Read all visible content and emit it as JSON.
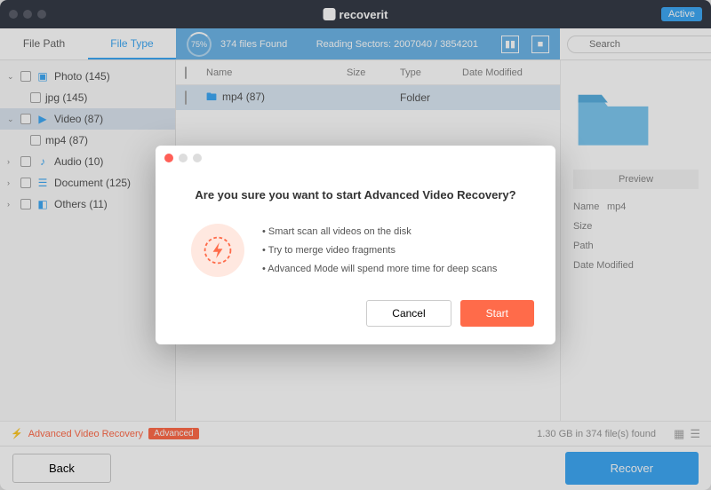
{
  "brand": "recoverit",
  "active_badge": "Active",
  "tabs": {
    "file_path": "File Path",
    "file_type": "File Type"
  },
  "scan": {
    "percent": "75%",
    "files_found": "374 files Found",
    "sectors": "Reading Sectors: 2007040 / 3854201"
  },
  "search": {
    "placeholder": "Search"
  },
  "sidebar": {
    "photo": {
      "label": "Photo (145)",
      "jpg": "jpg (145)"
    },
    "video": {
      "label": "Video (87)",
      "mp4": "mp4 (87)"
    },
    "audio": {
      "label": "Audio (10)"
    },
    "document": {
      "label": "Document (125)"
    },
    "others": {
      "label": "Others (11)"
    }
  },
  "columns": {
    "name": "Name",
    "size": "Size",
    "type": "Type",
    "date": "Date Modified"
  },
  "row": {
    "name": "mp4 (87)",
    "type": "Folder"
  },
  "preview": {
    "heading": "Preview",
    "name_lbl": "Name",
    "name_val": "mp4",
    "size_lbl": "Size",
    "path_lbl": "Path",
    "date_lbl": "Date Modified"
  },
  "adv": {
    "link": "Advanced Video Recovery",
    "tag": "Advanced",
    "stats": "1.30 GB in 374 file(s) found"
  },
  "footer": {
    "back": "Back",
    "recover": "Recover"
  },
  "dialog": {
    "heading": "Are you sure you want to start Advanced Video Recovery?",
    "b1": "• Smart scan all videos on the disk",
    "b2": "• Try to merge video fragments",
    "b3": "• Advanced Mode will spend more time for deep scans",
    "cancel": "Cancel",
    "start": "Start"
  }
}
